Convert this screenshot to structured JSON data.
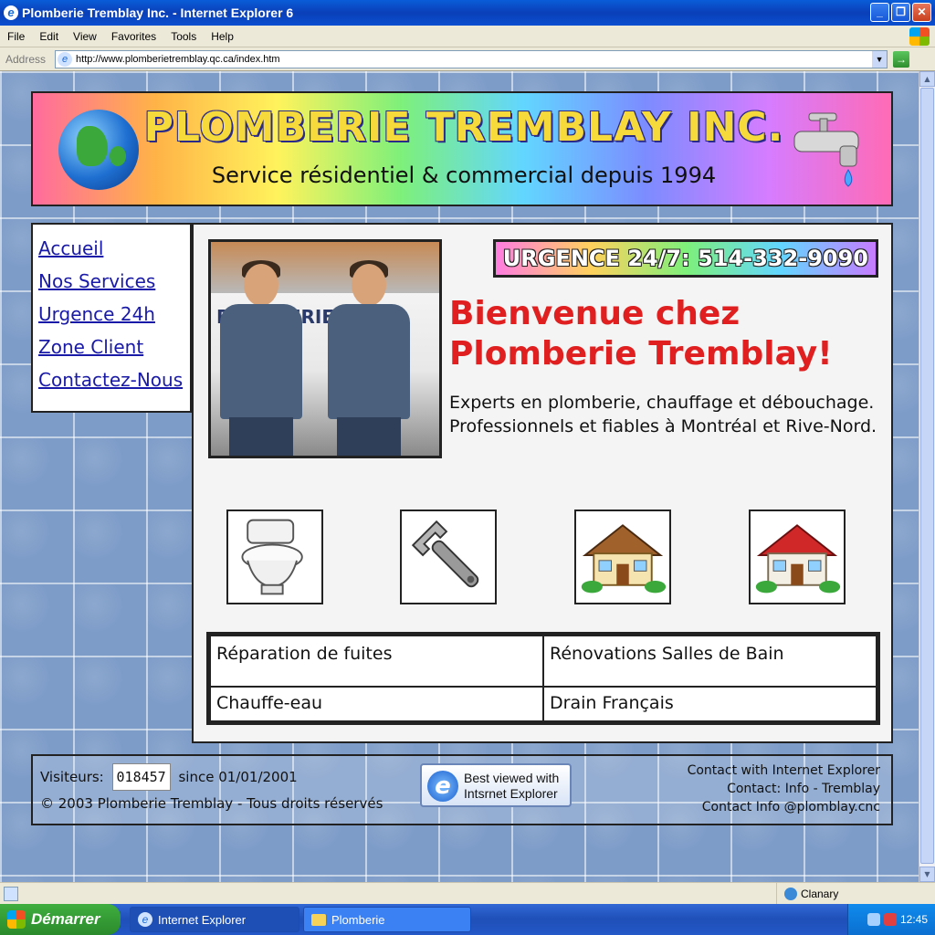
{
  "window": {
    "title": "Plomberie Tremblay Inc. - Internet Explorer 6",
    "minimize": "_",
    "restore": "❐",
    "close": "✕"
  },
  "menu": [
    "File",
    "Edit",
    "View",
    "Favorites",
    "Tools",
    "Help"
  ],
  "address": {
    "label": "Address",
    "url": "http://www.plomberietremblay.qc.ca/index.htm"
  },
  "banner": {
    "title": "PLOMBERIE TREMBLAY INC.",
    "subtitle": "Service résidentiel & commercial depuis 1994"
  },
  "nav": [
    "Accueil",
    "Nos Services",
    "Urgence 24h",
    "Zone Client",
    "Contactez-Nous"
  ],
  "main": {
    "photo_truck_text": "PLOMBERIE",
    "urgence": "URGENCE 24/7: 514-332-9090",
    "welcome_line1": "Bienvenue chez",
    "welcome_line2": "Plomberie Tremblay!",
    "intro": "Experts en plomberie, chauffage et débouchage. Professionnels et fiables à Montréal et Rive-Nord.",
    "icons": [
      "toilet-icon",
      "wrench-icon",
      "house-icon",
      "house-red-roof-icon"
    ],
    "services": [
      [
        "Réparation de fuites",
        "Rénovations Salles de Bain"
      ],
      [
        "Chauffe-eau",
        "Drain Français"
      ]
    ]
  },
  "footer": {
    "visitors_label": "Visiteurs:",
    "visitors_count": "018457",
    "since": "since 01/01/2001",
    "copyright": "© 2003 Plomberie Tremblay - Tous droits réservés",
    "best_viewed_line1": "Best viewed with",
    "best_viewed_line2": "Intsrnet Explorer",
    "contact_line1": "Contact with Internet Explorer",
    "contact_line2": "Contact: Info - Tremblay",
    "contact_line3": "Contact Info @plomblay.cnc"
  },
  "status": {
    "zone": "Clanary"
  },
  "taskbar": {
    "start": "Démarrer",
    "task1": "Internet Explorer",
    "task2": "Plomberie",
    "clock": "12:45"
  },
  "colors": {
    "welcome": "#e02020",
    "link": "#1a1aa8",
    "titlebar": "#0a5cd8"
  }
}
